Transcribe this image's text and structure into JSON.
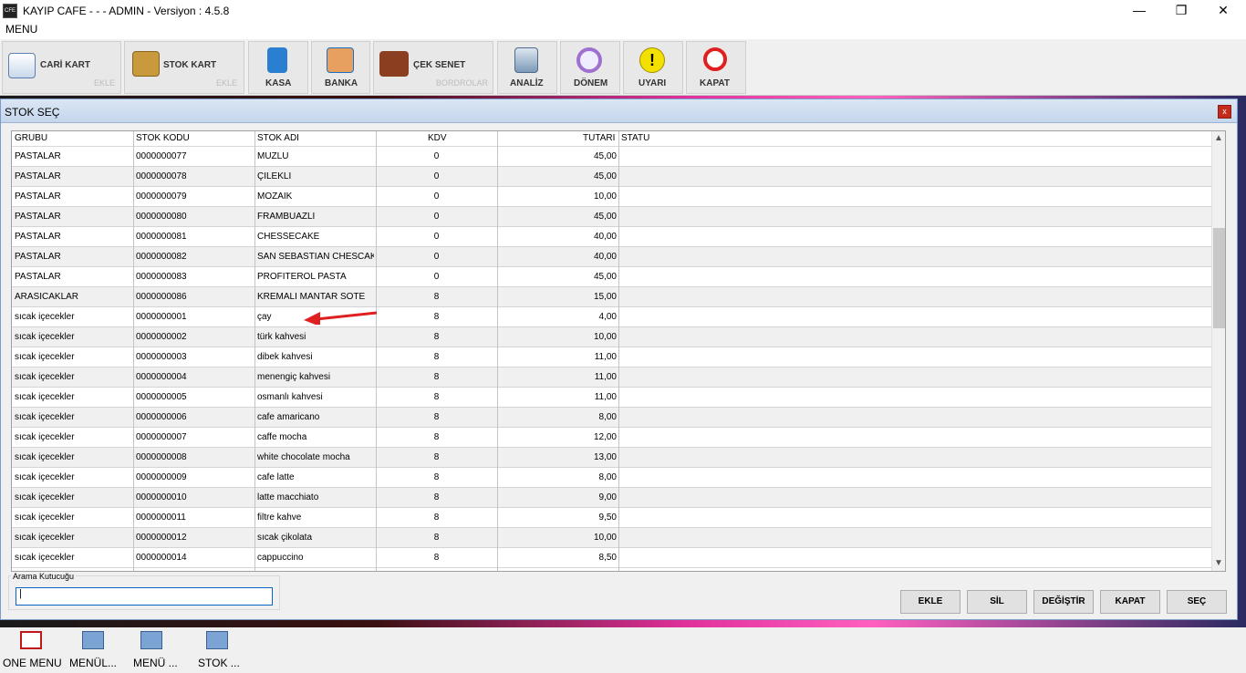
{
  "window": {
    "title": "KAYIP CAFE -  -  - ADMIN -  Versiyon : 4.5.8",
    "minimize": "—",
    "maximize": "❐",
    "close": "✕"
  },
  "menu": {
    "label": "MENU"
  },
  "toolbar": {
    "cari_kart": {
      "label": "CARİ KART",
      "sub": "EKLE"
    },
    "stok_kart": {
      "label": "STOK KART",
      "sub": "EKLE"
    },
    "kasa": {
      "label": "KASA"
    },
    "banka": {
      "label": "BANKA"
    },
    "cek_senet": {
      "label": "ÇEK SENET",
      "sub": "BORDROLAR"
    },
    "analiz": {
      "label": "ANALİZ"
    },
    "donem": {
      "label": "DÖNEM"
    },
    "uyari": {
      "label": "UYARI"
    },
    "kapat": {
      "label": "KAPAT"
    }
  },
  "dialog": {
    "title": "STOK SEÇ",
    "close": "x",
    "columns": {
      "grubu": "GRUBU",
      "stok_kodu": "STOK KODU",
      "stok_adi": "STOK ADI",
      "kdv": "KDV",
      "tutari": "TUTARI",
      "statu": "STATU"
    },
    "rows": [
      {
        "grubu": "PASTALAR",
        "kod": "0000000077",
        "adi": "MUZLU",
        "kdv": "0",
        "tutar": "45,00"
      },
      {
        "grubu": "PASTALAR",
        "kod": "0000000078",
        "adi": "ÇİLEKLİ",
        "kdv": "0",
        "tutar": "45,00"
      },
      {
        "grubu": "PASTALAR",
        "kod": "0000000079",
        "adi": "MOZAİK",
        "kdv": "0",
        "tutar": "10,00"
      },
      {
        "grubu": "PASTALAR",
        "kod": "0000000080",
        "adi": "FRAMBUAZLI",
        "kdv": "0",
        "tutar": "45,00"
      },
      {
        "grubu": "PASTALAR",
        "kod": "0000000081",
        "adi": "CHESSECAKE",
        "kdv": "0",
        "tutar": "40,00"
      },
      {
        "grubu": "PASTALAR",
        "kod": "0000000082",
        "adi": "SAN SEBASTİAN CHESCAKI",
        "kdv": "0",
        "tutar": "40,00"
      },
      {
        "grubu": "PASTALAR",
        "kod": "0000000083",
        "adi": "PROFİTEROL PASTA",
        "kdv": "0",
        "tutar": "45,00"
      },
      {
        "grubu": "ARASICAKLAR",
        "kod": "0000000086",
        "adi": "KREMALI MANTAR SOTE",
        "kdv": "8",
        "tutar": "15,00"
      },
      {
        "grubu": "sıcak içecekler",
        "kod": "0000000001",
        "adi": "çay",
        "kdv": "8",
        "tutar": "4,00"
      },
      {
        "grubu": "sıcak içecekler",
        "kod": "0000000002",
        "adi": "türk kahvesi",
        "kdv": "8",
        "tutar": "10,00"
      },
      {
        "grubu": "sıcak içecekler",
        "kod": "0000000003",
        "adi": "dibek kahvesi",
        "kdv": "8",
        "tutar": "11,00"
      },
      {
        "grubu": "sıcak içecekler",
        "kod": "0000000004",
        "adi": "menengiç kahvesi",
        "kdv": "8",
        "tutar": "11,00"
      },
      {
        "grubu": "sıcak içecekler",
        "kod": "0000000005",
        "adi": "osmanlı kahvesi",
        "kdv": "8",
        "tutar": "11,00"
      },
      {
        "grubu": "sıcak içecekler",
        "kod": "0000000006",
        "adi": "cafe amaricano",
        "kdv": "8",
        "tutar": "8,00"
      },
      {
        "grubu": "sıcak içecekler",
        "kod": "0000000007",
        "adi": "caffe mocha",
        "kdv": "8",
        "tutar": "12,00"
      },
      {
        "grubu": "sıcak içecekler",
        "kod": "0000000008",
        "adi": "white chocolate mocha",
        "kdv": "8",
        "tutar": "13,00"
      },
      {
        "grubu": "sıcak içecekler",
        "kod": "0000000009",
        "adi": "cafe latte",
        "kdv": "8",
        "tutar": "8,00"
      },
      {
        "grubu": "sıcak içecekler",
        "kod": "0000000010",
        "adi": "latte macchiato",
        "kdv": "8",
        "tutar": "9,00"
      },
      {
        "grubu": "sıcak içecekler",
        "kod": "0000000011",
        "adi": "filtre kahve",
        "kdv": "8",
        "tutar": "9,50"
      },
      {
        "grubu": "sıcak içecekler",
        "kod": "0000000012",
        "adi": "sıcak çikolata",
        "kdv": "8",
        "tutar": "10,00"
      },
      {
        "grubu": "sıcak içecekler",
        "kod": "0000000014",
        "adi": "cappuccino",
        "kdv": "8",
        "tutar": "8,50"
      }
    ],
    "search": {
      "label": "Arama Kutucuğu",
      "value": "|"
    },
    "buttons": {
      "ekle": "EKLE",
      "sil": "SİL",
      "degistir": "DEĞİŞTİR",
      "kapat": "KAPAT",
      "sec": "SEÇ"
    }
  },
  "taskbar": [
    {
      "label": "ONE MENU"
    },
    {
      "label": "MENÜL..."
    },
    {
      "label": "MENÜ ..."
    },
    {
      "label": "STOK ..."
    }
  ]
}
